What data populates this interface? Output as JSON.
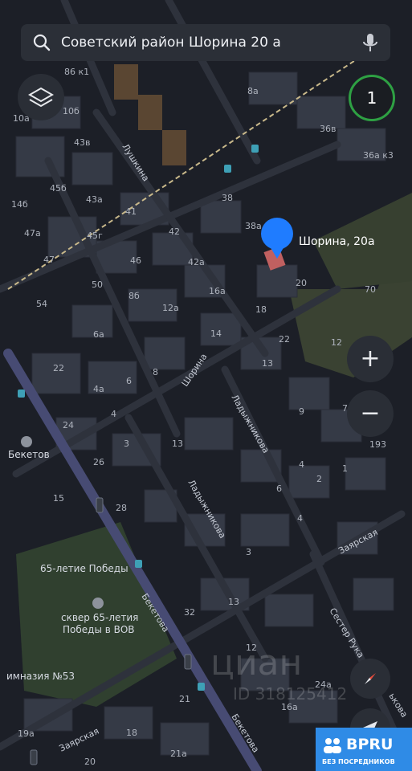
{
  "search": {
    "query": "Советский район Шорина 20 а"
  },
  "layer_count": "1",
  "zoom": {
    "in_label": "+",
    "out_label": "−"
  },
  "marker": {
    "label": "Шорина, 20а"
  },
  "streets": {
    "lushkina": "Лушкина",
    "shorina": "Шорина",
    "ladyzhnikova_1": "Ладыжникова",
    "ladyzhnikova_2": "Ладыжникова",
    "beketova_1": "Бекетова",
    "beketova_2": "Бекетова",
    "zayarskaya_1": "Заярская",
    "zayarskaya_2": "Заярская",
    "sester_rukav": "Сестер Рука",
    "beketova_cut": "ькова"
  },
  "pois": {
    "beketov": "Бекетов",
    "anniv_65": "65-летие Победы",
    "skver_1": "сквер 65-летия",
    "skver_2": "Победы в ВОВ",
    "gymnasium": "имназия №53"
  },
  "house_numbers": {
    "h20a": "20",
    "h86": "86 к1",
    "h10b": "10б",
    "h10a": "10а",
    "h43v": "43в",
    "h45b": "45б",
    "h14b": "14б",
    "h47a": "47а",
    "h47": "47",
    "h43a": "43а",
    "h41": "41",
    "h45g": "45г",
    "h42": "42",
    "h46": "46",
    "h42a": "42а",
    "h38": "38",
    "h38a": "38а",
    "h20": "20",
    "h16a": "16а",
    "h18": "18",
    "h50": "50",
    "h8b": "8б",
    "h12a": "12а",
    "h54": "54",
    "h6a": "6а",
    "h14": "14",
    "h22": "22",
    "h22b": "22",
    "h13": "13",
    "h8": "8",
    "h6": "6",
    "h4a": "4а",
    "h4": "4",
    "h24": "24",
    "h3": "3",
    "h13b": "13",
    "h26": "26",
    "h15": "15",
    "h28": "28",
    "h9": "9",
    "h7": "7",
    "h4b": "4",
    "h6b": "6",
    "h1": "1",
    "h4c": "4",
    "h2": "2",
    "h3b": "3",
    "h36v": "36в",
    "h36a": "36а к3",
    "h70": "70",
    "h12": "12",
    "h193": "193",
    "h13c": "13",
    "h32": "32",
    "h12b": "12",
    "h24a": "24а",
    "h16a2": "16а",
    "h21": "21",
    "h18b": "18",
    "h19a": "19а",
    "h20b": "20",
    "h21a": "21а",
    "h8a": "8а"
  },
  "watermark": {
    "brand": "циан",
    "id": "ID 318125412"
  },
  "bpru": {
    "brand": "BPRU",
    "tagline": "БЕЗ ПОСРЕДНИКОВ"
  },
  "colors": {
    "background": "#1c1f27",
    "road": "#2b2f38",
    "building": "#3a3f4a",
    "park": "#3a4a3a",
    "marker": "#1f7cff",
    "beketova_road": "#4b4f7a",
    "badge_ring": "#2ea043",
    "bpru_bg": "#2f8be6"
  }
}
